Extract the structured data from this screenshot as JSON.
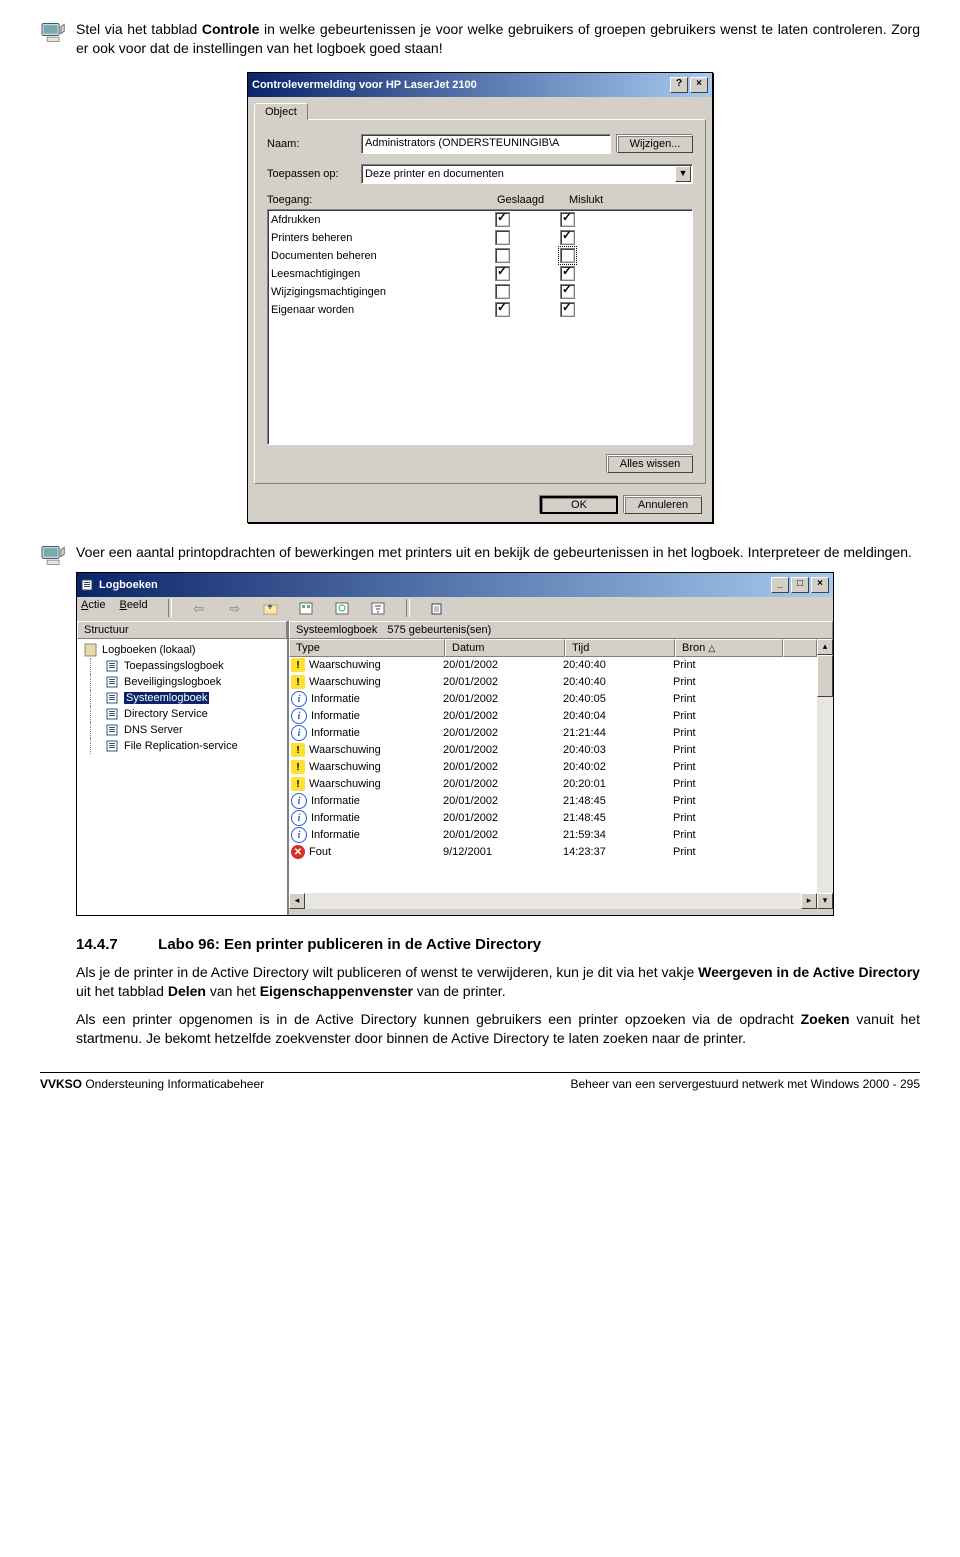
{
  "para1_pre": "Stel via het tabblad ",
  "para1_b1": "Controle",
  "para1_post": " in welke gebeurtenissen je voor welke gebruikers of groepen gebruikers wenst te laten controleren. Zorg er ook voor dat de instellingen van het logboek goed staan!",
  "dialog1": {
    "title": "Controlevermelding voor HP LaserJet 2100",
    "help": "?",
    "close": "×",
    "tab": "Object",
    "label_naam": "Naam:",
    "val_naam": "Administrators (ONDERSTEUNINGIB\\A",
    "btn_wijzigen": "Wijzigen...",
    "label_toepassen": "Toepassen op:",
    "val_toepassen": "Deze printer en documenten",
    "hdr_toegang": "Toegang:",
    "hdr_geslaagd": "Geslaagd",
    "hdr_mislukt": "Mislukt",
    "perms": [
      {
        "name": "Afdrukken",
        "g": true,
        "m": true
      },
      {
        "name": "Printers beheren",
        "g": false,
        "m": true
      },
      {
        "name": "Documenten beheren",
        "g": false,
        "m": false,
        "dotted": true
      },
      {
        "name": "Leesmachtigingen",
        "g": true,
        "m": true
      },
      {
        "name": "Wijzigingsmachtigingen",
        "g": false,
        "m": true
      },
      {
        "name": "Eigenaar worden",
        "g": true,
        "m": true
      }
    ],
    "btn_wissen": "Alles wissen",
    "btn_ok": "OK",
    "btn_annuleren": "Annuleren"
  },
  "para2": "Voer een aantal printopdrachten of bewerkingen met printers uit en bekijk de gebeurtenissen in het logboek. Interpreteer de meldingen.",
  "logwin": {
    "title": "Logboeken",
    "menu": [
      {
        "t": "Actie",
        "u": "A"
      },
      {
        "t": "Beeld",
        "u": "B"
      }
    ],
    "tree_head": "Structuur",
    "right_head_1": "Systeemlogboek",
    "right_head_2": "575 gebeurtenis(sen)",
    "tree_root": "Logboeken (lokaal)",
    "tree_items": [
      "Toepassingslogboek",
      "Beveiligingslogboek",
      "Systeemlogboek",
      "Directory Service",
      "DNS Server",
      "File Replication-service"
    ],
    "tree_sel_index": 2,
    "cols": [
      "Type",
      "Datum",
      "Tijd",
      "Bron"
    ],
    "rows": [
      {
        "t": "Waarschuwing",
        "i": "warn",
        "d": "20/01/2002",
        "h": "20:40:40",
        "b": "Print"
      },
      {
        "t": "Waarschuwing",
        "i": "warn",
        "d": "20/01/2002",
        "h": "20:40:40",
        "b": "Print"
      },
      {
        "t": "Informatie",
        "i": "info",
        "d": "20/01/2002",
        "h": "20:40:05",
        "b": "Print"
      },
      {
        "t": "Informatie",
        "i": "info",
        "d": "20/01/2002",
        "h": "20:40:04",
        "b": "Print"
      },
      {
        "t": "Informatie",
        "i": "info",
        "d": "20/01/2002",
        "h": "21:21:44",
        "b": "Print"
      },
      {
        "t": "Waarschuwing",
        "i": "warn",
        "d": "20/01/2002",
        "h": "20:40:03",
        "b": "Print"
      },
      {
        "t": "Waarschuwing",
        "i": "warn",
        "d": "20/01/2002",
        "h": "20:40:02",
        "b": "Print"
      },
      {
        "t": "Waarschuwing",
        "i": "warn",
        "d": "20/01/2002",
        "h": "20:20:01",
        "b": "Print"
      },
      {
        "t": "Informatie",
        "i": "info",
        "d": "20/01/2002",
        "h": "21:48:45",
        "b": "Print"
      },
      {
        "t": "Informatie",
        "i": "info",
        "d": "20/01/2002",
        "h": "21:48:45",
        "b": "Print"
      },
      {
        "t": "Informatie",
        "i": "info",
        "d": "20/01/2002",
        "h": "21:59:34",
        "b": "Print"
      },
      {
        "t": "Fout",
        "i": "err",
        "d": "9/12/2001",
        "h": "14:23:37",
        "b": "Print"
      }
    ]
  },
  "heading_nr": "14.4.7",
  "heading_txt": "Labo 96: Een printer publiceren in de Active Directory",
  "para3_pre": "Als je de printer in de Active Directory wilt publiceren of wenst te verwijderen, kun je dit via het vakje ",
  "para3_b1": "Weergeven in de Active Directory",
  "para3_mid": " uit het tabblad ",
  "para3_b2": "Delen",
  "para3_mid2": " van het ",
  "para3_b3": "Eigenschappenvenster",
  "para3_post": " van de printer.",
  "para4_pre": "Als een printer opgenomen is in de Active Directory kunnen gebruikers een printer opzoeken via de opdracht ",
  "para4_b1": "Zoeken",
  "para4_post": " vanuit het startmenu. Je bekomt hetzelfde zoekvenster door binnen de Active Directory te laten zoeken naar de printer.",
  "footer_left_b": "VVKSO",
  "footer_left": "   Ondersteuning Informaticabeheer",
  "footer_right": "Beheer van een servergestuurd netwerk met Windows 2000 -  295"
}
